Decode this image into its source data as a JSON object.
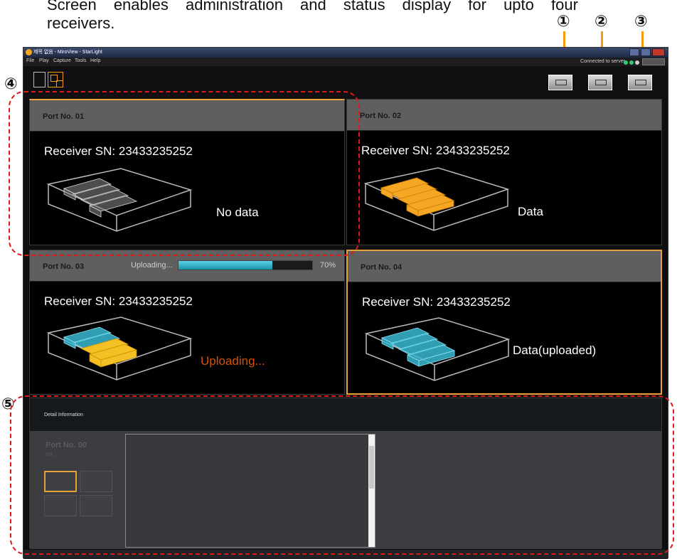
{
  "doc": {
    "line1": "Screen enables administration and status display for upto four",
    "line2": "receivers."
  },
  "markers": [
    "①",
    "②",
    "③",
    "④",
    "⑤"
  ],
  "window": {
    "title": "제목 없음 - MiroView - StarLight",
    "menu": [
      "File",
      "Play",
      "Capture",
      "Tools",
      "Help"
    ],
    "connection": "Connected to server"
  },
  "ports": [
    {
      "title": "Port No. 01",
      "sn": "Receiver SN: 23433235252",
      "status": "No data"
    },
    {
      "title": "Port No. 02",
      "sn": "Receiver SN: 23433235252",
      "status": "Data"
    },
    {
      "title": "Port No. 03",
      "sn": "Receiver SN: 23433235252",
      "status": "Uploading...",
      "upload_label": "Uploading...",
      "progress_text": "70%",
      "progress": 0.7
    },
    {
      "title": "Port No. 04",
      "sn": "Receiver SN: 23433235252",
      "status": "Data(uploaded)"
    }
  ],
  "detail": {
    "header": "Detail Information",
    "port": "Port No. 00",
    "sn": "SN :"
  },
  "colors": {
    "accent": "#e8a23a",
    "uploading": "#d35400",
    "cyan": "#3ab9d2",
    "highlight_dash": "#e0191b"
  }
}
